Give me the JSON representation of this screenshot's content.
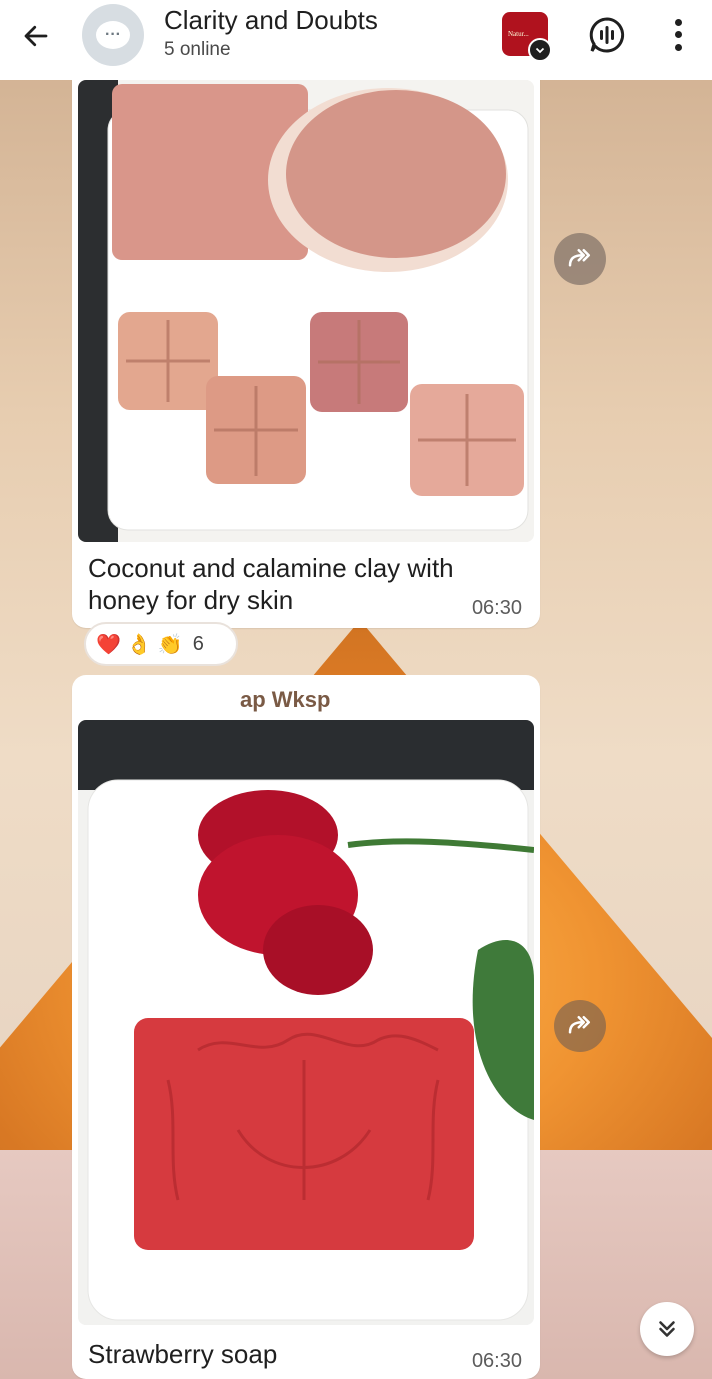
{
  "header": {
    "title": "Clarity and Doubts",
    "subtitle": "5 online",
    "profile_logo_text": "Natur..."
  },
  "messages": [
    {
      "caption": "Coconut and calamine clay with honey for dry skin",
      "time": "06:30",
      "reactions": {
        "emojis": [
          "❤️",
          "👌",
          "👏"
        ],
        "count": "6"
      }
    },
    {
      "sender": "ap Wksp",
      "caption": "Strawberry soap",
      "time": "06:30"
    }
  ],
  "icons": {
    "back": "arrow-left-icon",
    "group_avatar": "chat-bubble-icon",
    "voice_chat": "voice-chat-icon",
    "menu": "more-vertical-icon",
    "forward": "forward-icon",
    "scroll_down": "double-chevron-down-icon"
  }
}
